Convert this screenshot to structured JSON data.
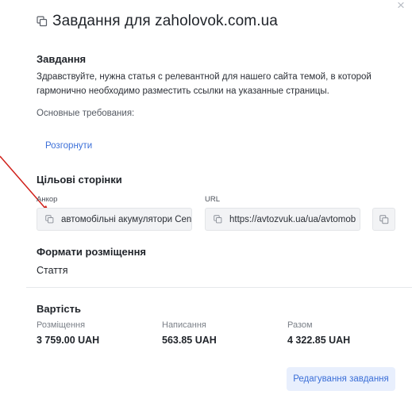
{
  "dialog": {
    "title": "Завдання для zaholovok.com.ua",
    "close_icon": "close-icon"
  },
  "task": {
    "heading": "Завдання",
    "text": "Здравствуйте, нужна статья с релевантной для нашего сайта темой, в которой гармонично необходимо разместить ссылки на указанные страницы.",
    "requirements_label": "Основные требования:",
    "expand_link": "Розгорнути"
  },
  "target_pages": {
    "heading": "Цільові сторінки",
    "anchor_label": "Анкор",
    "anchor_value": "автомобільні акумулятори Cen",
    "url_label": "URL",
    "url_value": "https://avtozvuk.ua/ua/avtomob"
  },
  "formats": {
    "heading": "Формати розміщення",
    "value": "Стаття"
  },
  "cost": {
    "heading": "Вартість",
    "placement_label": "Розміщення",
    "placement_value": "3 759.00 UAH",
    "writing_label": "Написання",
    "writing_value": "563.85 UAH",
    "total_label": "Разом",
    "total_value": "4 322.85 UAH"
  },
  "actions": {
    "edit_button": "Редагування завдання"
  },
  "colors": {
    "accent": "#3b6fd8",
    "button_bg": "#e8effd",
    "field_bg": "#f2f3f5",
    "annotation_arrow": "#d0201a"
  }
}
